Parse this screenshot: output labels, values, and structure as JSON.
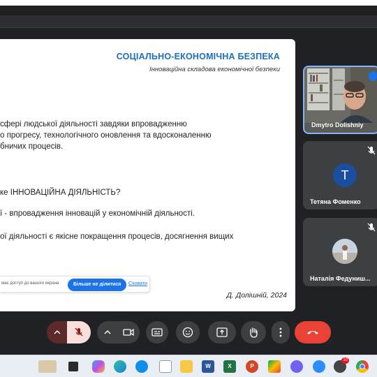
{
  "slide": {
    "title": "СОЦІАЛЬНО-ЕКОНОМІЧНА БЕЗПЕКА",
    "subtitle": "Інноваційна складова економічної безпеки",
    "lines": [
      "сфері людської діяльності завдяки впровадженню",
      "о прогресу, технологічного оновлення та вдосконаленню",
      "бничих процесів."
    ],
    "question": "ке ІННОВАЦІЙНА ДІЯЛЬНІСТЬ?",
    "definition": "ї - впровадження інновацій у економічній діяльності.",
    "goal": "ої діяльності є якісне покращення процесів, досягнення вищих",
    "author": "Д. Долішній, 2024"
  },
  "share_bar": {
    "text": "має доступ до вашого екрана",
    "stop_label": "Більше не ділитися",
    "hide_label": "Сховати"
  },
  "participants": [
    {
      "name": "Dmytro Dolishniy",
      "speaking": true
    },
    {
      "name": "Тетяна Фоменко",
      "initial": "T",
      "muted": true
    },
    {
      "name": "Наталія Федуниш...",
      "muted": true
    }
  ],
  "colors": {
    "title_blue": "#1b6fc1",
    "meet_bg": "#202124",
    "tile_bg": "#3c4043",
    "leave_red": "#ea4335",
    "mic_off_bg": "#f9dedc",
    "accent_blue": "#1a73e8"
  },
  "controls": [
    "chevron-up-icon",
    "mic-off-icon",
    "chevron-up-icon",
    "camera-icon",
    "captions-icon",
    "emoji-icon",
    "present-icon",
    "raise-hand-icon",
    "more-vert-icon",
    "call-end-icon"
  ],
  "taskbar_apps": [
    "widgets",
    "task-view",
    "copilot",
    "edge",
    "teamviewer",
    "file",
    "file-explorer",
    "word",
    "excel",
    "powerpoint",
    "meet",
    "viber",
    "zoom",
    "badge-app",
    "chrome"
  ],
  "taskbar_badge": "10"
}
